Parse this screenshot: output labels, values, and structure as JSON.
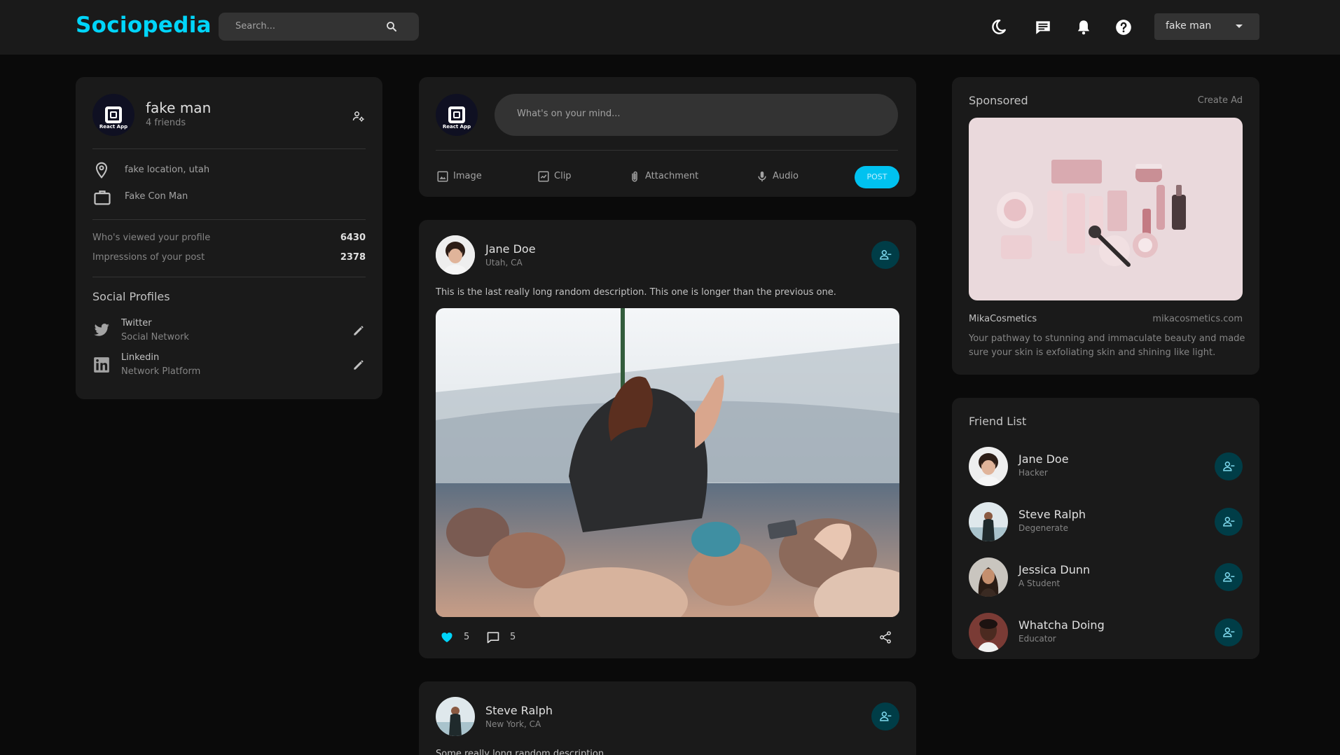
{
  "navbar": {
    "logo": "Sociopedia",
    "search_placeholder": "Search...",
    "user_name": "fake man",
    "icons": [
      "moon-icon",
      "message-icon",
      "bell-icon",
      "help-icon",
      "search-icon"
    ]
  },
  "user_widget": {
    "name": "fake man",
    "friends": "4 friends",
    "avatar_text": "React App",
    "location": "fake location, utah",
    "occupation": "Fake Con Man",
    "viewed_label": "Who's viewed your profile",
    "viewed_value": "6430",
    "impressions_label": "Impressions of your post",
    "impressions_value": "2378",
    "social_title": "Social Profiles",
    "socials": [
      {
        "name": "Twitter",
        "type": "Social Network"
      },
      {
        "name": "Linkedin",
        "type": "Network Platform"
      }
    ]
  },
  "composer": {
    "placeholder": "What's on your mind...",
    "actions": [
      "Image",
      "Clip",
      "Attachment",
      "Audio"
    ],
    "post_label": "POST"
  },
  "posts": [
    {
      "name": "Jane Doe",
      "location": "Utah, CA",
      "description": "This is the last really long random description. This one is longer than the previous one.",
      "likes": "5",
      "comments": "5"
    },
    {
      "name": "Steve Ralph",
      "location": "New York, CA",
      "description": "Some really long random description"
    }
  ],
  "sponsored": {
    "title": "Sponsored",
    "create_ad": "Create Ad",
    "brand": "MikaCosmetics",
    "url": "mikacosmetics.com",
    "description_line1": "Your pathway to stunning and immaculate beauty and made",
    "description_line2": "sure your skin is exfoliating skin and shining like light."
  },
  "friend_list": {
    "title": "Friend List",
    "friends": [
      {
        "name": "Jane Doe",
        "occupation": "Hacker"
      },
      {
        "name": "Steve Ralph",
        "occupation": "Degenerate"
      },
      {
        "name": "Jessica Dunn",
        "occupation": "A Student"
      },
      {
        "name": "Whatcha Doing",
        "occupation": "Educator"
      }
    ]
  },
  "colors": {
    "accent": "#00d5fa",
    "background": "#0a0a0a",
    "card": "#1a1a1a",
    "input": "#333333"
  }
}
